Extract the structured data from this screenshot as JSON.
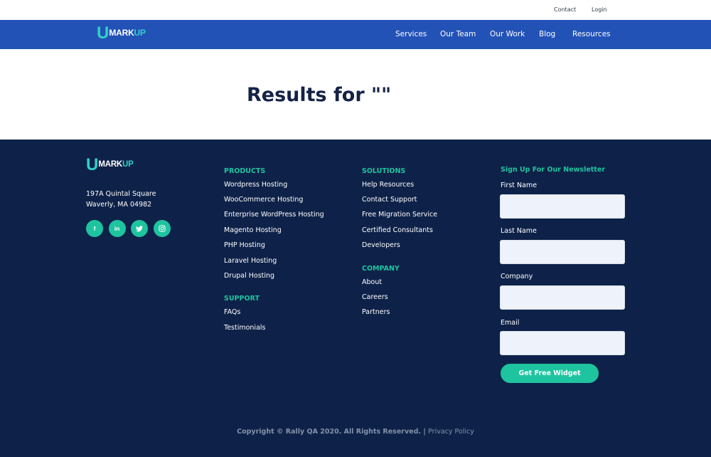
{
  "topbar": {
    "contact": "Contact",
    "login": "Login"
  },
  "brand": {
    "logo_u": "U",
    "logo_mark": "MARK",
    "logo_up": "UP"
  },
  "nav": {
    "items": [
      "Services",
      "Our Team",
      "Our Work",
      "Blog",
      "Resources"
    ]
  },
  "results": {
    "title": "Results for \"\""
  },
  "footer": {
    "address_line1": "197A Quintal Square",
    "address_line2": "Waverly, MA 04982",
    "socials": [
      {
        "icon": "facebook-icon",
        "glyph": "f"
      },
      {
        "icon": "linkedin-icon",
        "glyph": "in"
      },
      {
        "icon": "twitter-icon",
        "glyph": "t"
      },
      {
        "icon": "instagram-icon",
        "glyph": "◎"
      }
    ],
    "products": {
      "heading": "PRODUCTS",
      "items": [
        "Wordpress Hosting",
        "WooCommerce Hosting",
        "Enterprise WordPress Hosting",
        "Magento Hosting",
        "PHP Hosting",
        "Laravel Hosting",
        "Drupal Hosting"
      ]
    },
    "support": {
      "heading": "SUPPORT",
      "items": [
        "FAQs",
        "Testimonials"
      ]
    },
    "solutions": {
      "heading": "SOLUTIONS",
      "items": [
        "Help Resources",
        "Contact Support",
        "Free Migration Service",
        "Certified Consultants",
        "Developers"
      ]
    },
    "company": {
      "heading": "COMPANY",
      "items": [
        "About",
        "Careers",
        "Partners"
      ]
    },
    "newsletter": {
      "title": "Sign Up For Our Newsletter",
      "first_name_label": "First Name",
      "last_name_label": "Last Name",
      "company_label": "Company",
      "email_label": "Email",
      "button": "Get Free Widget"
    },
    "copyright": "Copyright © Rally QA 2020. All Rights Reserved.",
    "separator": "|",
    "privacy": "Privacy Policy"
  },
  "colors": {
    "nav_blue": "#2352b7",
    "footer_navy": "#0e2249",
    "accent_teal": "#1ec49f",
    "logo_cyan": "#2fd3c5",
    "title_navy": "#142247"
  }
}
